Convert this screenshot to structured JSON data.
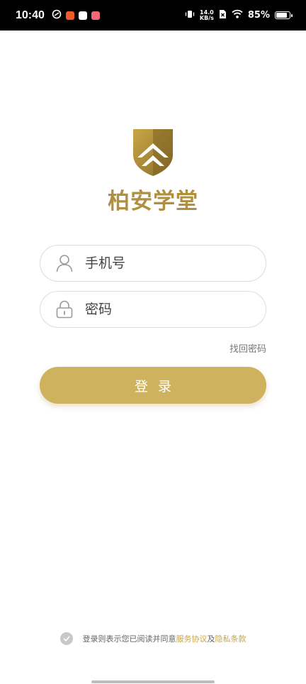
{
  "status_bar": {
    "time": "10:40",
    "net_speed_value": "14.0",
    "net_speed_unit": "KB/s",
    "battery": "85%",
    "battery_level": 0.85,
    "icons": [
      "app-notification-icon",
      "vibrate-icon",
      "no-sim-icon",
      "wifi-icon",
      "battery-icon"
    ]
  },
  "logo": {
    "brand": "柏安学堂",
    "icon": "shield-chevron-logo",
    "color": "#b08f3f"
  },
  "form": {
    "phone_placeholder": "手机号",
    "password_placeholder": "密码",
    "forgot_label": "找回密码",
    "login_label": "登录",
    "button_color": "#cfb25e"
  },
  "agreement": {
    "prefix": "登录则表示您已阅读并同意",
    "terms_link": "服务协议",
    "conjunction": "及",
    "privacy_link": "隐私条款",
    "link_color": "#c9a548"
  }
}
